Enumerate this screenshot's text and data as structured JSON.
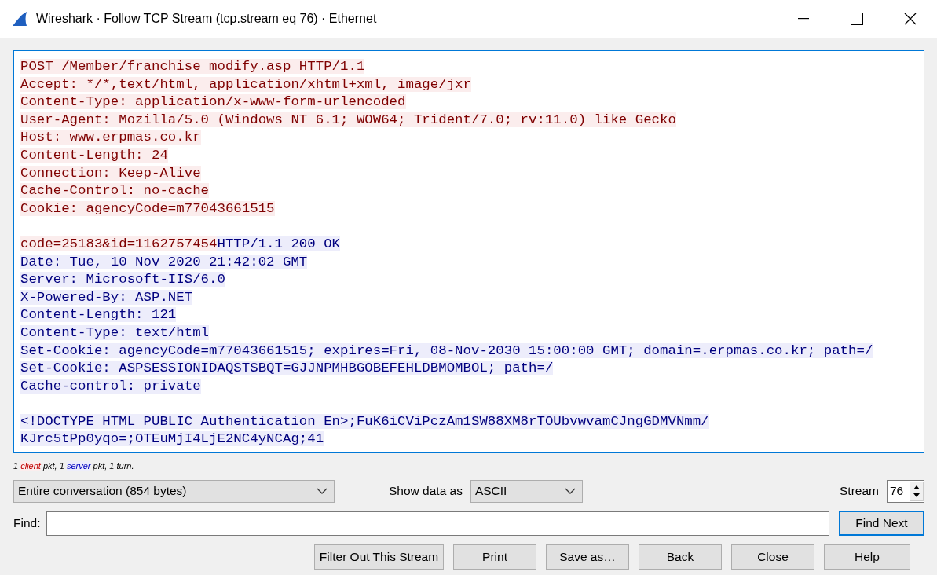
{
  "window": {
    "title": "Wireshark · Follow TCP Stream (tcp.stream eq 76) · Ethernet"
  },
  "stream_blocks": [
    {
      "lines": [
        {
          "segments": [
            {
              "kind": "client",
              "text": "POST /Member/franchise_modify.asp HTTP/1.1"
            }
          ]
        },
        {
          "segments": [
            {
              "kind": "client",
              "text": "Accept: */*,text/html, application/xhtml+xml, image/jxr"
            }
          ]
        },
        {
          "segments": [
            {
              "kind": "client",
              "text": "Content-Type: application/x-www-form-urlencoded"
            }
          ]
        },
        {
          "segments": [
            {
              "kind": "client",
              "text": "User-Agent: Mozilla/5.0 (Windows NT 6.1; WOW64; Trident/7.0; rv:11.0) like Gecko"
            }
          ]
        },
        {
          "segments": [
            {
              "kind": "client",
              "text": "Host: www.erpmas.co.kr"
            }
          ]
        },
        {
          "segments": [
            {
              "kind": "client",
              "text": "Content-Length: 24"
            }
          ]
        },
        {
          "segments": [
            {
              "kind": "client",
              "text": "Connection: Keep-Alive"
            }
          ]
        },
        {
          "segments": [
            {
              "kind": "client",
              "text": "Cache-Control: no-cache"
            }
          ]
        },
        {
          "segments": [
            {
              "kind": "client",
              "text": "Cookie: agencyCode=m77043661515"
            }
          ]
        }
      ]
    },
    {
      "lines": [
        {
          "segments": [
            {
              "kind": "client",
              "text": "code=25183&id=1162757454"
            },
            {
              "kind": "server",
              "text": "HTTP/1.1 200 OK"
            }
          ]
        },
        {
          "segments": [
            {
              "kind": "server",
              "text": "Date: Tue, 10 Nov 2020 21:42:02 GMT"
            }
          ]
        },
        {
          "segments": [
            {
              "kind": "server",
              "text": "Server: Microsoft-IIS/6.0"
            }
          ]
        },
        {
          "segments": [
            {
              "kind": "server",
              "text": "X-Powered-By: ASP.NET"
            }
          ]
        },
        {
          "segments": [
            {
              "kind": "server",
              "text": "Content-Length: 121"
            }
          ]
        },
        {
          "segments": [
            {
              "kind": "server",
              "text": "Content-Type: text/html"
            }
          ]
        },
        {
          "segments": [
            {
              "kind": "server",
              "text": "Set-Cookie: agencyCode=m77043661515; expires=Fri, 08-Nov-2030 15:00:00 GMT; domain=.erpmas.co.kr; path=/"
            }
          ]
        },
        {
          "segments": [
            {
              "kind": "server",
              "text": "Set-Cookie: ASPSESSIONIDAQSTSBQT=GJJNPMHBGOBEFEHLDBMOMBOL; path=/"
            }
          ]
        },
        {
          "segments": [
            {
              "kind": "server",
              "text": "Cache-control: private"
            }
          ]
        }
      ]
    },
    {
      "lines": [
        {
          "segments": [
            {
              "kind": "server",
              "text": "<!DOCTYPE HTML PUBLIC Authentication En>;FuK6iCViPczAm1SW88XM8rTOUbvwvamCJngGDMVNmm/"
            }
          ]
        },
        {
          "segments": [
            {
              "kind": "server",
              "text": "KJrc5tPp0yqo=;OTEuMjI4LjE2NC4yNCAg;41"
            }
          ]
        }
      ]
    }
  ],
  "summary": [
    {
      "kind": "plain",
      "text": "1 "
    },
    {
      "kind": "client",
      "text": "client"
    },
    {
      "kind": "plain",
      "text": " pkt, 1 "
    },
    {
      "kind": "server",
      "text": "server"
    },
    {
      "kind": "plain",
      "text": " pkt, 1 turn."
    }
  ],
  "conversation_select": {
    "value": "Entire conversation (854 bytes)"
  },
  "show_data_as": {
    "label": "Show data as",
    "value": "ASCII"
  },
  "stream": {
    "label": "Stream",
    "value": "76"
  },
  "find": {
    "label": "Find:",
    "button": "Find Next"
  },
  "buttons": [
    "Filter Out This Stream",
    "Print",
    "Save as…",
    "Back",
    "Close",
    "Help"
  ]
}
